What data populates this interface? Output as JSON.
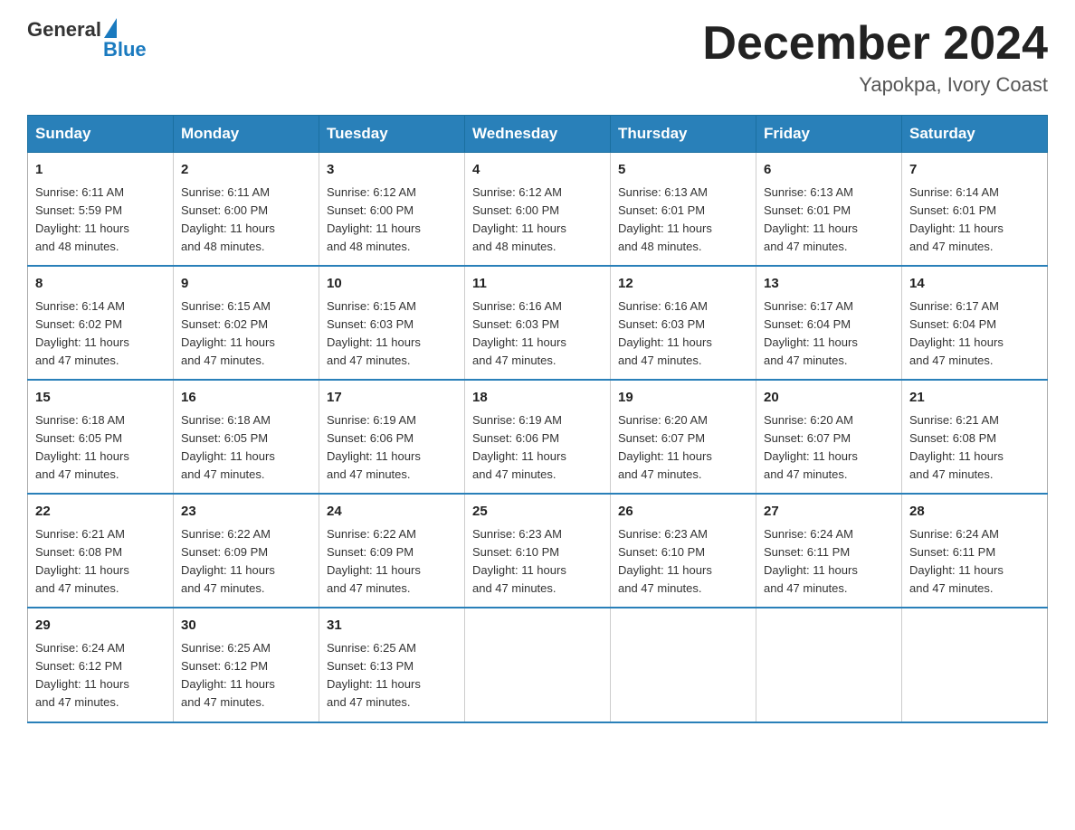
{
  "header": {
    "logo": {
      "general": "General",
      "blue": "Blue"
    },
    "title": "December 2024",
    "location": "Yapokpa, Ivory Coast"
  },
  "days_of_week": [
    "Sunday",
    "Monday",
    "Tuesday",
    "Wednesday",
    "Thursday",
    "Friday",
    "Saturday"
  ],
  "weeks": [
    [
      {
        "day": "1",
        "sunrise": "6:11 AM",
        "sunset": "5:59 PM",
        "daylight": "11 hours and 48 minutes."
      },
      {
        "day": "2",
        "sunrise": "6:11 AM",
        "sunset": "6:00 PM",
        "daylight": "11 hours and 48 minutes."
      },
      {
        "day": "3",
        "sunrise": "6:12 AM",
        "sunset": "6:00 PM",
        "daylight": "11 hours and 48 minutes."
      },
      {
        "day": "4",
        "sunrise": "6:12 AM",
        "sunset": "6:00 PM",
        "daylight": "11 hours and 48 minutes."
      },
      {
        "day": "5",
        "sunrise": "6:13 AM",
        "sunset": "6:01 PM",
        "daylight": "11 hours and 48 minutes."
      },
      {
        "day": "6",
        "sunrise": "6:13 AM",
        "sunset": "6:01 PM",
        "daylight": "11 hours and 47 minutes."
      },
      {
        "day": "7",
        "sunrise": "6:14 AM",
        "sunset": "6:01 PM",
        "daylight": "11 hours and 47 minutes."
      }
    ],
    [
      {
        "day": "8",
        "sunrise": "6:14 AM",
        "sunset": "6:02 PM",
        "daylight": "11 hours and 47 minutes."
      },
      {
        "day": "9",
        "sunrise": "6:15 AM",
        "sunset": "6:02 PM",
        "daylight": "11 hours and 47 minutes."
      },
      {
        "day": "10",
        "sunrise": "6:15 AM",
        "sunset": "6:03 PM",
        "daylight": "11 hours and 47 minutes."
      },
      {
        "day": "11",
        "sunrise": "6:16 AM",
        "sunset": "6:03 PM",
        "daylight": "11 hours and 47 minutes."
      },
      {
        "day": "12",
        "sunrise": "6:16 AM",
        "sunset": "6:03 PM",
        "daylight": "11 hours and 47 minutes."
      },
      {
        "day": "13",
        "sunrise": "6:17 AM",
        "sunset": "6:04 PM",
        "daylight": "11 hours and 47 minutes."
      },
      {
        "day": "14",
        "sunrise": "6:17 AM",
        "sunset": "6:04 PM",
        "daylight": "11 hours and 47 minutes."
      }
    ],
    [
      {
        "day": "15",
        "sunrise": "6:18 AM",
        "sunset": "6:05 PM",
        "daylight": "11 hours and 47 minutes."
      },
      {
        "day": "16",
        "sunrise": "6:18 AM",
        "sunset": "6:05 PM",
        "daylight": "11 hours and 47 minutes."
      },
      {
        "day": "17",
        "sunrise": "6:19 AM",
        "sunset": "6:06 PM",
        "daylight": "11 hours and 47 minutes."
      },
      {
        "day": "18",
        "sunrise": "6:19 AM",
        "sunset": "6:06 PM",
        "daylight": "11 hours and 47 minutes."
      },
      {
        "day": "19",
        "sunrise": "6:20 AM",
        "sunset": "6:07 PM",
        "daylight": "11 hours and 47 minutes."
      },
      {
        "day": "20",
        "sunrise": "6:20 AM",
        "sunset": "6:07 PM",
        "daylight": "11 hours and 47 minutes."
      },
      {
        "day": "21",
        "sunrise": "6:21 AM",
        "sunset": "6:08 PM",
        "daylight": "11 hours and 47 minutes."
      }
    ],
    [
      {
        "day": "22",
        "sunrise": "6:21 AM",
        "sunset": "6:08 PM",
        "daylight": "11 hours and 47 minutes."
      },
      {
        "day": "23",
        "sunrise": "6:22 AM",
        "sunset": "6:09 PM",
        "daylight": "11 hours and 47 minutes."
      },
      {
        "day": "24",
        "sunrise": "6:22 AM",
        "sunset": "6:09 PM",
        "daylight": "11 hours and 47 minutes."
      },
      {
        "day": "25",
        "sunrise": "6:23 AM",
        "sunset": "6:10 PM",
        "daylight": "11 hours and 47 minutes."
      },
      {
        "day": "26",
        "sunrise": "6:23 AM",
        "sunset": "6:10 PM",
        "daylight": "11 hours and 47 minutes."
      },
      {
        "day": "27",
        "sunrise": "6:24 AM",
        "sunset": "6:11 PM",
        "daylight": "11 hours and 47 minutes."
      },
      {
        "day": "28",
        "sunrise": "6:24 AM",
        "sunset": "6:11 PM",
        "daylight": "11 hours and 47 minutes."
      }
    ],
    [
      {
        "day": "29",
        "sunrise": "6:24 AM",
        "sunset": "6:12 PM",
        "daylight": "11 hours and 47 minutes."
      },
      {
        "day": "30",
        "sunrise": "6:25 AM",
        "sunset": "6:12 PM",
        "daylight": "11 hours and 47 minutes."
      },
      {
        "day": "31",
        "sunrise": "6:25 AM",
        "sunset": "6:13 PM",
        "daylight": "11 hours and 47 minutes."
      },
      null,
      null,
      null,
      null
    ]
  ],
  "labels": {
    "sunrise": "Sunrise:",
    "sunset": "Sunset:",
    "daylight": "Daylight:"
  }
}
